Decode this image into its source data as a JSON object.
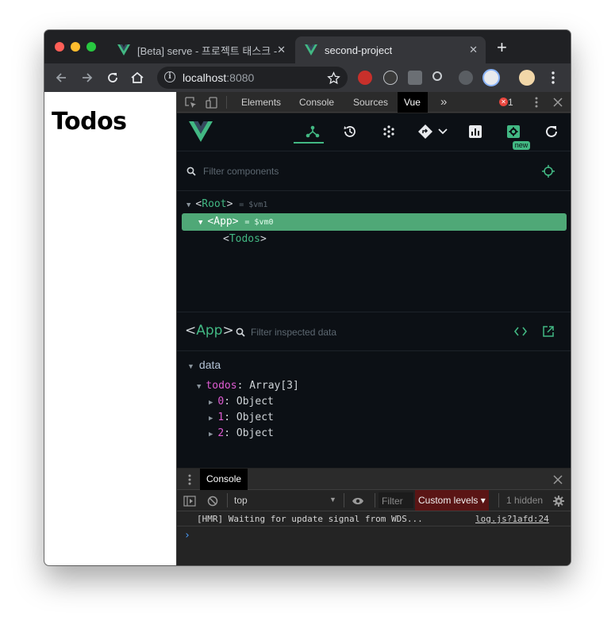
{
  "browser": {
    "tabs": [
      {
        "label": "[Beta] serve - 프로젝트 태스크 - Vu",
        "active": false
      },
      {
        "label": "second-project",
        "active": true
      }
    ],
    "close_glyph": "✕",
    "new_tab_glyph": "+",
    "url_host": "localhost",
    "url_port": ":8080",
    "info_glyph": "i"
  },
  "page": {
    "heading": "Todos"
  },
  "devtools": {
    "tabs": [
      "Elements",
      "Console",
      "Sources",
      "Vue"
    ],
    "active_tab": "Vue",
    "more_glyph": "»",
    "error_count": "1",
    "vue": {
      "new_badge": "new",
      "filter_components_placeholder": "Filter components",
      "tree": [
        {
          "open": "<",
          "tag": "Root",
          "close": ">",
          "vm": "= $vm1",
          "selected": false
        },
        {
          "open": "<",
          "tag": "App",
          "close": ">",
          "vm": "= $vm0",
          "selected": true
        },
        {
          "open": "<",
          "tag": "Todos",
          "close": ">",
          "vm": "",
          "selected": false
        }
      ],
      "inspected_component": {
        "open": "<",
        "tag": "App",
        "close": ">"
      },
      "filter_data_placeholder": "Filter inspected data",
      "data_section": "data",
      "todos": {
        "key": "todos",
        "value": "Array[3]"
      },
      "items": [
        {
          "key": "0",
          "value": "Object"
        },
        {
          "key": "1",
          "value": "Object"
        },
        {
          "key": "2",
          "value": "Object"
        }
      ]
    },
    "console": {
      "drawer_tab": "Console",
      "context": "top",
      "filter_placeholder": "Filter",
      "levels": "Custom levels ▾",
      "hidden": "1 hidden",
      "log_message": "[HMR] Waiting for update signal from WDS...",
      "log_source": "log.js?1afd:24",
      "prompt": "›"
    }
  },
  "colors": {
    "vue_green": "#42b883",
    "selected_row": "#4fa877",
    "key_pink": "#e05cd4"
  }
}
